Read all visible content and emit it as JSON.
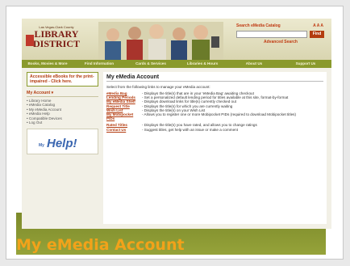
{
  "slide_caption": "My eMedia Account",
  "header": {
    "logo_top": "Las Vegas-Clark County",
    "logo_line1": "LIBRARY",
    "logo_line2": "DISTRICT",
    "search_title": "Search eMedia Catalog",
    "font_sizes": "A A A",
    "find_button": "Find",
    "advanced_search": "Advanced Search"
  },
  "nav": [
    "Books, Movies & More",
    "Find Information",
    "Cards & Services",
    "Libraries & Hours",
    "About Us",
    "Support Us"
  ],
  "sidebar": {
    "promo": "Accessible eBooks for the print-impaired - Click here.",
    "account_heading": "My Account ▾",
    "items": [
      "• Library Home",
      "• eMedia Catalog",
      "• My eMedia Account",
      "• eMedia Help",
      "• Compatible Devices",
      "• Log Out"
    ],
    "help_text": "Help!",
    "help_prefix": "My"
  },
  "main": {
    "title": "My eMedia Account",
    "intro": "Select from the following links to manage your eMedia account:",
    "links": [
      {
        "name": "eMedia Bag",
        "desc": "- Displays the title(s) that are in your 'eMedia Bag' awaiting checkout"
      },
      {
        "name": "Lending Periods",
        "desc": "- Set a personalized default lending period for titles available at this site, format-by-format"
      },
      {
        "name": "My eMedia Shelf",
        "desc": "- Displays download links for title(s) currently checked out"
      },
      {
        "name": "Request Title",
        "desc": "- Displays the title(s) for which you are currently waiting"
      },
      {
        "name": "Wish List",
        "desc": "- Displays the title(s) on your Wish List"
      },
      {
        "name": "My Mobipocket PIDs",
        "desc": "- Allows you to register one or more Mobipocket PIDs (required to download Mobipocket titles)"
      },
      {
        "name": "Rated Titles",
        "desc": "- Displays the title(s) you have rated, and allows you to change ratings"
      },
      {
        "name": "Contact Us",
        "desc": "- Suggest titles, get help with an issue or make a comment"
      }
    ]
  }
}
